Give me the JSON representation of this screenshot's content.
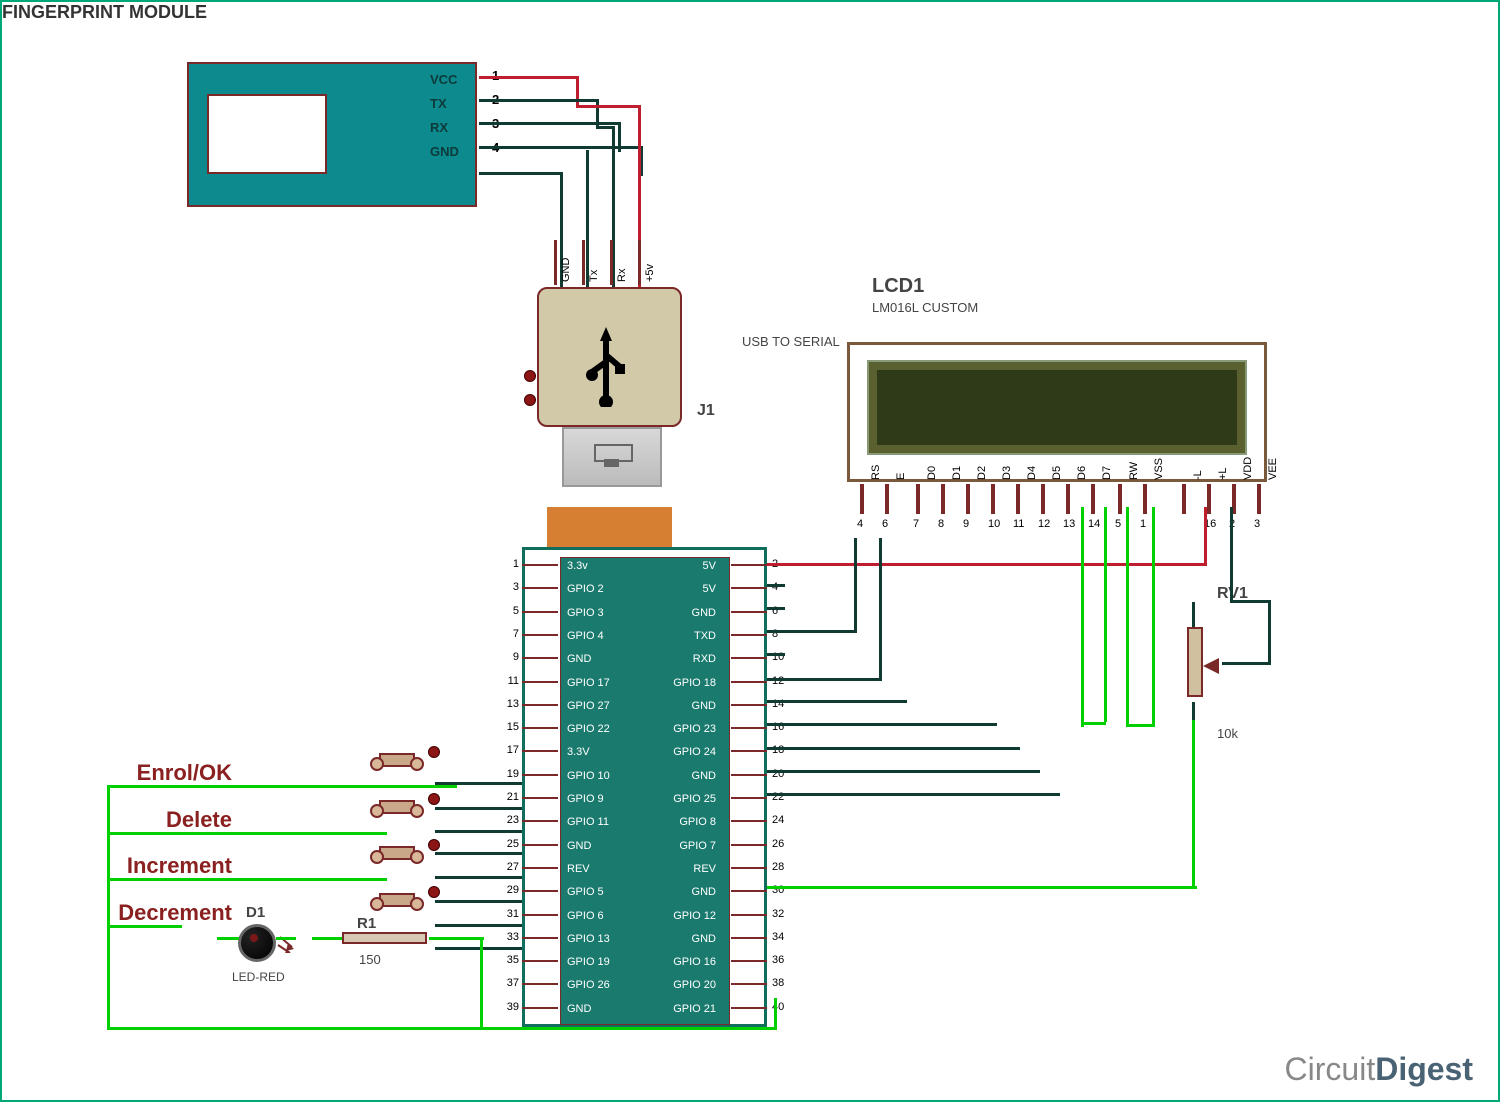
{
  "fingerprint_module": {
    "title": "FINGERPRINT MODULE",
    "pins": [
      {
        "num": "1",
        "label": "VCC"
      },
      {
        "num": "2",
        "label": "TX"
      },
      {
        "num": "3",
        "label": "RX"
      },
      {
        "num": "4",
        "label": "GND"
      }
    ]
  },
  "usb_serial": {
    "ref": "J1",
    "description": "USB TO SERIAL",
    "pins": [
      "GND",
      "Tx",
      "Rx",
      "+5v"
    ]
  },
  "lcd": {
    "ref": "LCD1",
    "part": "LM016L CUSTOM",
    "pins": [
      {
        "label": "RS",
        "num": "4"
      },
      {
        "label": "E",
        "num": "6"
      },
      {
        "label": "D0",
        "num": "7"
      },
      {
        "label": "D1",
        "num": "8"
      },
      {
        "label": "D2",
        "num": "9"
      },
      {
        "label": "D3",
        "num": "10"
      },
      {
        "label": "D4",
        "num": "11"
      },
      {
        "label": "D5",
        "num": "12"
      },
      {
        "label": "D6",
        "num": "13"
      },
      {
        "label": "D7",
        "num": "14"
      },
      {
        "label": "RW",
        "num": "5"
      },
      {
        "label": "VSS",
        "num": "1"
      },
      {
        "label": "-L",
        "num": ""
      },
      {
        "label": "+L",
        "num": "16"
      },
      {
        "label": "VDD",
        "num": "2"
      },
      {
        "label": "VEE",
        "num": "3"
      }
    ]
  },
  "rpi": {
    "left_pins": [
      {
        "num": "1",
        "label": "3.3v"
      },
      {
        "num": "3",
        "label": "GPIO 2"
      },
      {
        "num": "5",
        "label": "GPIO 3"
      },
      {
        "num": "7",
        "label": "GPIO 4"
      },
      {
        "num": "9",
        "label": "GND"
      },
      {
        "num": "11",
        "label": "GPIO 17"
      },
      {
        "num": "13",
        "label": "GPIO 27"
      },
      {
        "num": "15",
        "label": "GPIO 22"
      },
      {
        "num": "17",
        "label": "3.3V"
      },
      {
        "num": "19",
        "label": "GPIO 10"
      },
      {
        "num": "21",
        "label": "GPIO 9"
      },
      {
        "num": "23",
        "label": "GPIO 11"
      },
      {
        "num": "25",
        "label": "GND"
      },
      {
        "num": "27",
        "label": "REV"
      },
      {
        "num": "29",
        "label": "GPIO 5"
      },
      {
        "num": "31",
        "label": "GPIO 6"
      },
      {
        "num": "33",
        "label": "GPIO 13"
      },
      {
        "num": "35",
        "label": "GPIO 19"
      },
      {
        "num": "37",
        "label": "GPIO 26"
      },
      {
        "num": "39",
        "label": "GND"
      }
    ],
    "right_pins": [
      {
        "num": "2",
        "label": "5V"
      },
      {
        "num": "4",
        "label": "5V"
      },
      {
        "num": "6",
        "label": "GND"
      },
      {
        "num": "8",
        "label": "TXD"
      },
      {
        "num": "10",
        "label": "RXD"
      },
      {
        "num": "12",
        "label": "GPIO 18"
      },
      {
        "num": "14",
        "label": "GND"
      },
      {
        "num": "16",
        "label": "GPIO 23"
      },
      {
        "num": "18",
        "label": "GPIO 24"
      },
      {
        "num": "20",
        "label": "GND"
      },
      {
        "num": "22",
        "label": "GPIO 25"
      },
      {
        "num": "24",
        "label": "GPIO 8"
      },
      {
        "num": "26",
        "label": "GPIO 7"
      },
      {
        "num": "28",
        "label": "REV"
      },
      {
        "num": "30",
        "label": "GND"
      },
      {
        "num": "32",
        "label": "GPIO 12"
      },
      {
        "num": "34",
        "label": "GND"
      },
      {
        "num": "36",
        "label": "GPIO 16"
      },
      {
        "num": "38",
        "label": "GPIO 20"
      },
      {
        "num": "40",
        "label": "GPIO 21"
      }
    ]
  },
  "buttons": {
    "0": {
      "label": "Enrol/OK"
    },
    "1": {
      "label": "Delete"
    },
    "2": {
      "label": "Increment"
    },
    "3": {
      "label": "Decrement"
    }
  },
  "led": {
    "ref": "D1",
    "part": "LED-RED"
  },
  "resistor": {
    "ref": "R1",
    "value": "150"
  },
  "pot": {
    "ref": "RV1",
    "value": "10k"
  },
  "brand": {
    "part1": "Circuit",
    "part2": "Digest"
  }
}
